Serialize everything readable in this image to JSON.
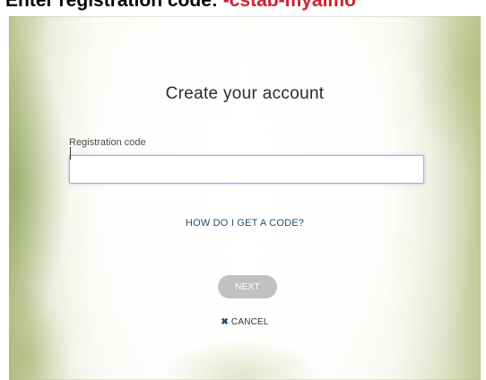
{
  "instruction": {
    "prefix": "Enter registration code: ",
    "code": "-cstab-myalmo"
  },
  "form": {
    "title": "Create your account",
    "field_label": "Registration code",
    "input_value": "",
    "help_link": "HOW DO I GET A CODE?",
    "next_label": "NEXT",
    "cancel_label": "CANCEL",
    "cancel_icon": "close-icon"
  },
  "colors": {
    "instruction_code": "#d0202f",
    "link": "#1f4e6e",
    "input_focus_border": "#8fb6d8",
    "next_disabled": "#c1c1c1"
  }
}
